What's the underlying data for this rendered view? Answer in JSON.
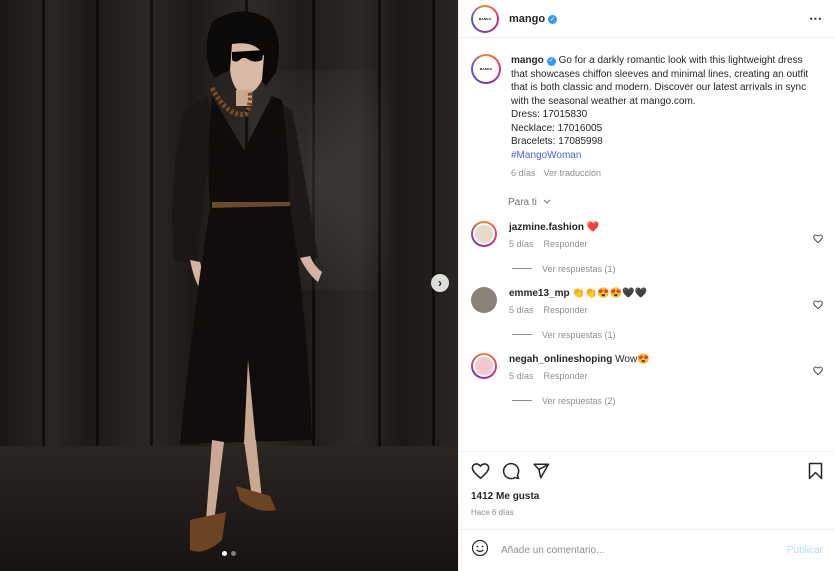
{
  "post": {
    "username": "mango",
    "avatar_text": "MANGO",
    "caption": "Go for a darkly romantic look with this lightweight dress that showcases chiffon sleeves and minimal lines, creating an outfit that is both classic and modern. Discover our latest arrivals in sync with the seasonal weather at mango.com.",
    "products": [
      "Dress: 17015830",
      "Necklace: 17016005",
      "Bracelets: 17085998"
    ],
    "hashtag": "#MangoWoman",
    "caption_age": "6 días",
    "see_translation": "Ver traducción",
    "filter_label": "Para ti",
    "likes": "1412 Me gusta",
    "posted": "Hace 6 días",
    "add_comment_placeholder": "Añade un comentario...",
    "publish_label": "Publicar",
    "more_icon": "⋯",
    "carousel_next": "›"
  },
  "comments": [
    {
      "username": "jazmine.fashion",
      "text": "❤️",
      "age": "5 días",
      "reply": "Responder",
      "view_replies": "Ver respuestas (1)",
      "avatar_color": "#e8d9c8"
    },
    {
      "username": "emme13_mp",
      "text": "👏👏😍😍🖤🖤",
      "age": "5 días",
      "reply": "Responder",
      "view_replies": "Ver respuestas (1)",
      "avatar_color": "#8a8378"
    },
    {
      "username": "negah_onlineshoping",
      "text": "Wow😍",
      "age": "5 días",
      "reply": "Responder",
      "view_replies": "Ver respuestas (2)",
      "avatar_color": "#f3c9cf"
    }
  ],
  "icons": {
    "like": "heart-icon",
    "comment": "comment-icon",
    "share": "paper-plane-icon",
    "save": "bookmark-icon",
    "emoji": "emoji-icon",
    "verified": "verified-badge-icon"
  },
  "colors": {
    "accent_blue": "#3897f0",
    "hashtag": "#4a64d8",
    "muted": "#8e8e8e",
    "publish_disabled": "#b2dffc"
  }
}
